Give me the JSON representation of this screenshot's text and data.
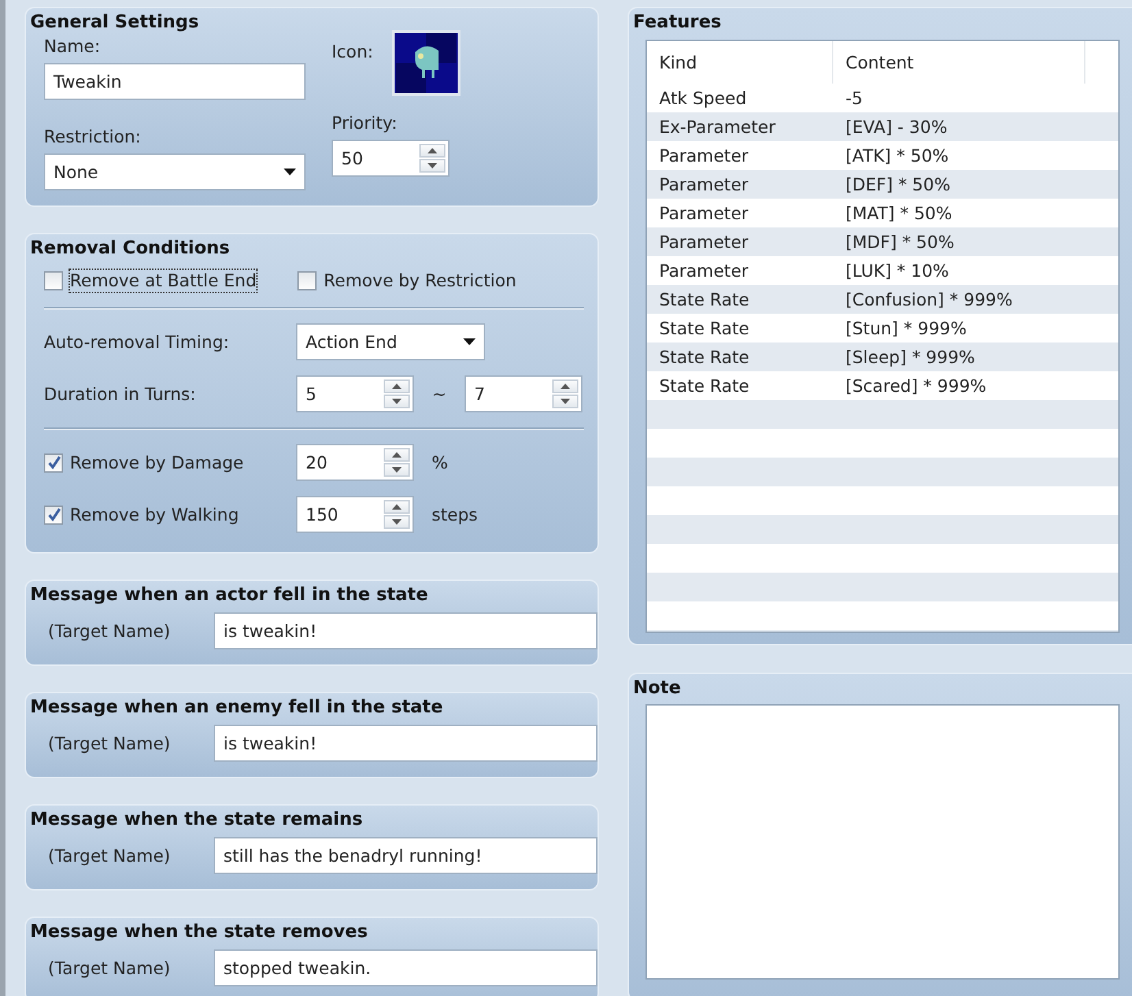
{
  "general_settings": {
    "title": "General Settings",
    "name_label": "Name:",
    "name_value": "Tweakin",
    "icon_label": "Icon:",
    "restriction_label": "Restriction:",
    "restriction_value": "None",
    "priority_label": "Priority:",
    "priority_value": "50"
  },
  "removal_conditions": {
    "title": "Removal Conditions",
    "checkboxes": [
      {
        "label": "Remove at Battle End",
        "checked": false,
        "focused": true
      },
      {
        "label": "Remove by Restriction",
        "checked": false,
        "focused": false
      }
    ],
    "timing_label": "Auto-removal Timing:",
    "timing_value": "Action End",
    "duration_label": "Duration in Turns:",
    "duration_min": "5",
    "duration_separator": "~",
    "duration_max": "7",
    "options": [
      {
        "label": "Remove by Damage",
        "checked": true,
        "value": "20",
        "unit": "%"
      },
      {
        "label": "Remove by Walking",
        "checked": true,
        "value": "150",
        "unit": "steps"
      }
    ]
  },
  "messages": [
    {
      "title": "Message when an actor fell in the state",
      "prefix": "(Target Name)",
      "value": "is tweakin!"
    },
    {
      "title": "Message when an enemy fell in the state",
      "prefix": "(Target Name)",
      "value": "is tweakin!"
    },
    {
      "title": "Message when the state remains",
      "prefix": "(Target Name)",
      "value": "still has the benadryl running!"
    },
    {
      "title": "Message when the state removes",
      "prefix": "(Target Name)",
      "value": "stopped tweakin."
    }
  ],
  "features": {
    "title": "Features",
    "columns": [
      "Kind",
      "Content"
    ],
    "rows": [
      [
        "Atk Speed",
        "-5"
      ],
      [
        "Ex-Parameter",
        "[EVA] - 30%"
      ],
      [
        "Parameter",
        "[ATK] * 50%"
      ],
      [
        "Parameter",
        "[DEF] * 50%"
      ],
      [
        "Parameter",
        "[MAT] * 50%"
      ],
      [
        "Parameter",
        "[MDF] * 50%"
      ],
      [
        "Parameter",
        "[LUK] * 10%"
      ],
      [
        "State Rate",
        "[Confusion] * 999%"
      ],
      [
        "State Rate",
        "[Stun] * 999%"
      ],
      [
        "State Rate",
        "[Sleep] * 999%"
      ],
      [
        "State Rate",
        "[Scared] * 999%"
      ]
    ]
  },
  "note": {
    "title": "Note"
  }
}
